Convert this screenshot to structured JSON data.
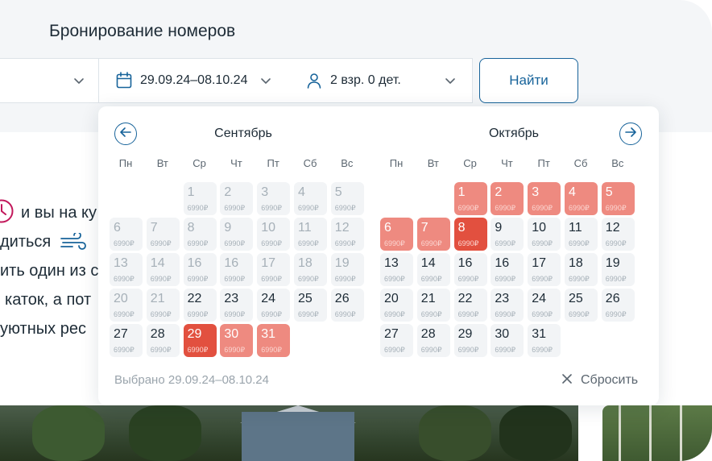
{
  "page": {
    "title": "Бронирование номеров"
  },
  "search": {
    "dates_value": "29.09.24–08.10.24",
    "guests_value": "2 взр. 0 дет.",
    "find_label": "Найти"
  },
  "background_text": [
    "и вы на ку",
    "диться",
    "ить один из с",
    "каток, а пот",
    "уютных рес"
  ],
  "calendar": {
    "weekdays": [
      "Пн",
      "Вт",
      "Ср",
      "Чт",
      "Пт",
      "Сб",
      "Вс"
    ],
    "months": [
      {
        "name": "Сентябрь",
        "first_weekday": 2,
        "days": [
          {
            "n": "1",
            "price": "6990₽",
            "state": "past"
          },
          {
            "n": "2",
            "price": "6990₽",
            "state": "past"
          },
          {
            "n": "3",
            "price": "6990₽",
            "state": "past"
          },
          {
            "n": "4",
            "price": "6990₽",
            "state": "past"
          },
          {
            "n": "5",
            "price": "6990₽",
            "state": "past"
          },
          {
            "n": "6",
            "price": "6990₽",
            "state": "past"
          },
          {
            "n": "7",
            "price": "6990₽",
            "state": "past"
          },
          {
            "n": "8",
            "price": "6990₽",
            "state": "past"
          },
          {
            "n": "9",
            "price": "6990₽",
            "state": "past"
          },
          {
            "n": "10",
            "price": "6990₽",
            "state": "past"
          },
          {
            "n": "11",
            "price": "6990₽",
            "state": "past"
          },
          {
            "n": "12",
            "price": "6990₽",
            "state": "past"
          },
          {
            "n": "13",
            "price": "6990₽",
            "state": "past"
          },
          {
            "n": "14",
            "price": "6990₽",
            "state": "past"
          },
          {
            "n": "16",
            "price": "6990₽",
            "state": "past"
          },
          {
            "n": "16",
            "price": "6990₽",
            "state": "past"
          },
          {
            "n": "17",
            "price": "6990₽",
            "state": "past"
          },
          {
            "n": "18",
            "price": "6990₽",
            "state": "past"
          },
          {
            "n": "19",
            "price": "6990₽",
            "state": "past"
          },
          {
            "n": "20",
            "price": "6990₽",
            "state": "past"
          },
          {
            "n": "21",
            "price": "6990₽",
            "state": "past"
          },
          {
            "n": "22",
            "price": "6990₽",
            "state": "avail"
          },
          {
            "n": "23",
            "price": "6990₽",
            "state": "avail"
          },
          {
            "n": "24",
            "price": "6990₽",
            "state": "avail"
          },
          {
            "n": "25",
            "price": "6990₽",
            "state": "avail"
          },
          {
            "n": "26",
            "price": "6990₽",
            "state": "avail"
          },
          {
            "n": "27",
            "price": "6990₽",
            "state": "avail"
          },
          {
            "n": "28",
            "price": "6990₽",
            "state": "avail"
          },
          {
            "n": "29",
            "price": "6990₽",
            "state": "edge"
          },
          {
            "n": "30",
            "price": "6990₽",
            "state": "in-range"
          },
          {
            "n": "31",
            "price": "6990₽",
            "state": "in-range"
          }
        ]
      },
      {
        "name": "Октябрь",
        "first_weekday": 2,
        "days": [
          {
            "n": "1",
            "price": "6990₽",
            "state": "in-range"
          },
          {
            "n": "2",
            "price": "6990₽",
            "state": "in-range"
          },
          {
            "n": "3",
            "price": "6990₽",
            "state": "in-range"
          },
          {
            "n": "4",
            "price": "6990₽",
            "state": "in-range"
          },
          {
            "n": "5",
            "price": "6990₽",
            "state": "in-range"
          },
          {
            "n": "6",
            "price": "6990₽",
            "state": "in-range"
          },
          {
            "n": "7",
            "price": "6990₽",
            "state": "in-range"
          },
          {
            "n": "8",
            "price": "6990₽",
            "state": "edge"
          },
          {
            "n": "9",
            "price": "6990₽",
            "state": "avail"
          },
          {
            "n": "10",
            "price": "6990₽",
            "state": "avail"
          },
          {
            "n": "11",
            "price": "6990₽",
            "state": "avail"
          },
          {
            "n": "12",
            "price": "6990₽",
            "state": "avail"
          },
          {
            "n": "13",
            "price": "6990₽",
            "state": "avail"
          },
          {
            "n": "14",
            "price": "6990₽",
            "state": "avail"
          },
          {
            "n": "16",
            "price": "6990₽",
            "state": "avail"
          },
          {
            "n": "16",
            "price": "6990₽",
            "state": "avail"
          },
          {
            "n": "17",
            "price": "6990₽",
            "state": "avail"
          },
          {
            "n": "18",
            "price": "6990₽",
            "state": "avail"
          },
          {
            "n": "19",
            "price": "6990₽",
            "state": "avail"
          },
          {
            "n": "20",
            "price": "6990₽",
            "state": "avail"
          },
          {
            "n": "21",
            "price": "6990₽",
            "state": "avail"
          },
          {
            "n": "22",
            "price": "6990₽",
            "state": "avail"
          },
          {
            "n": "23",
            "price": "6990₽",
            "state": "avail"
          },
          {
            "n": "24",
            "price": "6990₽",
            "state": "avail"
          },
          {
            "n": "25",
            "price": "6990₽",
            "state": "avail"
          },
          {
            "n": "26",
            "price": "6990₽",
            "state": "avail"
          },
          {
            "n": "27",
            "price": "6990₽",
            "state": "avail"
          },
          {
            "n": "28",
            "price": "6990₽",
            "state": "avail"
          },
          {
            "n": "29",
            "price": "6990₽",
            "state": "avail"
          },
          {
            "n": "30",
            "price": "6990₽",
            "state": "avail"
          },
          {
            "n": "31",
            "price": "6990₽",
            "state": "avail"
          }
        ]
      }
    ],
    "selected_text": "Выбрано 29.09.24–08.10.24",
    "reset_label": "Сбросить"
  },
  "icons": {
    "dates": "calendar-icon",
    "guests": "user-icon",
    "dropdown": "chevron-down-icon",
    "prev": "arrow-left-icon",
    "next": "arrow-right-icon",
    "reset": "close-icon",
    "clock": "clock-icon",
    "wind": "wind-icon"
  },
  "colors": {
    "accent": "#17639a",
    "range": "#ee8a80",
    "range_edge": "#e2503f",
    "clock_icon": "#c2185b"
  }
}
